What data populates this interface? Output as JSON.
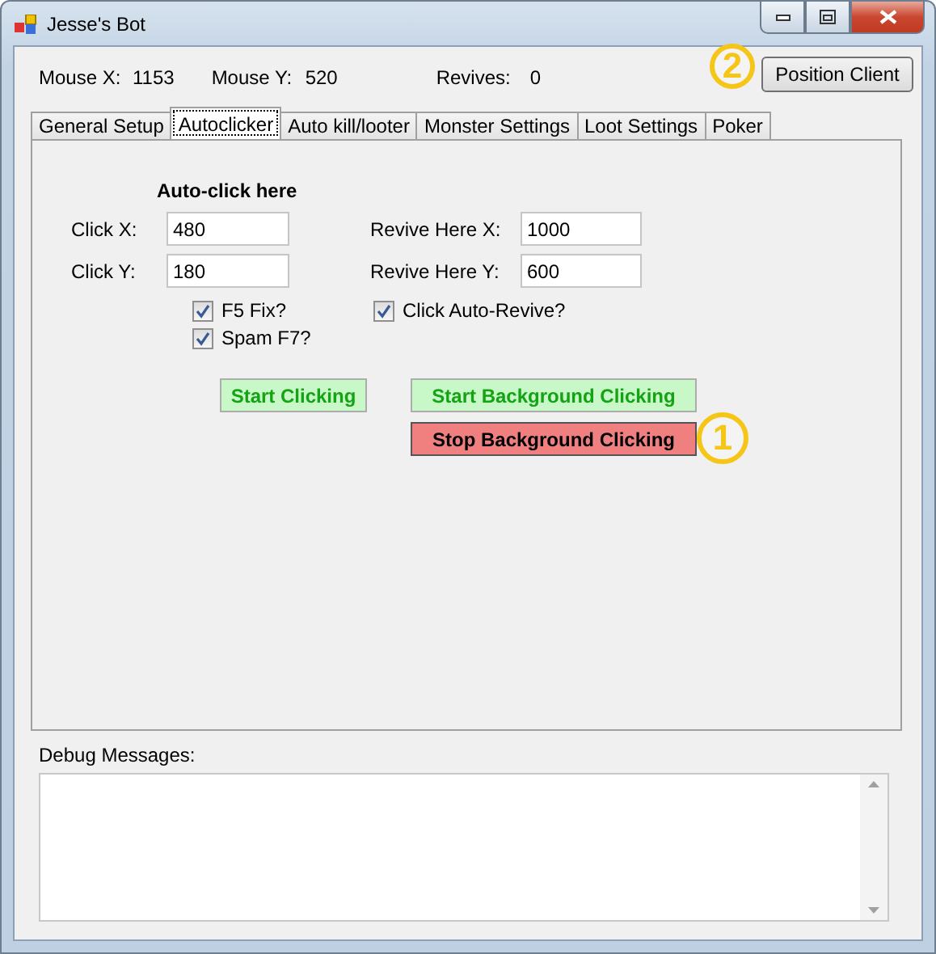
{
  "window": {
    "title": "Jesse's Bot"
  },
  "readouts": [
    {
      "label": "Mouse X:",
      "value": "1153"
    },
    {
      "label": "Mouse Y:",
      "value": "520"
    },
    {
      "label": "Revives:",
      "value": "0"
    }
  ],
  "position_button": {
    "label": "Position Client",
    "annotation": "2"
  },
  "tabs": [
    {
      "label": "General Setup",
      "selected": false
    },
    {
      "label": "Autoclicker",
      "selected": true
    },
    {
      "label": "Auto kill/looter",
      "selected": false
    },
    {
      "label": "Monster Settings",
      "selected": false
    },
    {
      "label": "Loot Settings",
      "selected": false
    },
    {
      "label": "Poker",
      "selected": false
    }
  ],
  "autoclicker": {
    "heading": "Auto-click here",
    "fields": [
      {
        "label": "Click X:",
        "value": "480"
      },
      {
        "label": "Revive Here X:",
        "value": "1000"
      },
      {
        "label": "Click Y:",
        "value": "180"
      },
      {
        "label": "Revive Here Y:",
        "value": "600"
      }
    ],
    "checkboxes": [
      {
        "label": "F5 Fix?",
        "checked": true
      },
      {
        "label": "Click Auto-Revive?",
        "checked": true
      },
      {
        "label": "Spam F7?",
        "checked": true
      }
    ],
    "buttons": [
      {
        "label": "Start Clicking",
        "kind": "start"
      },
      {
        "label": "Start Background Clicking",
        "kind": "start"
      },
      {
        "label": "Stop Background Clicking",
        "kind": "stop",
        "annotation": "1"
      }
    ]
  },
  "debug": {
    "label": "Debug Messages:"
  }
}
